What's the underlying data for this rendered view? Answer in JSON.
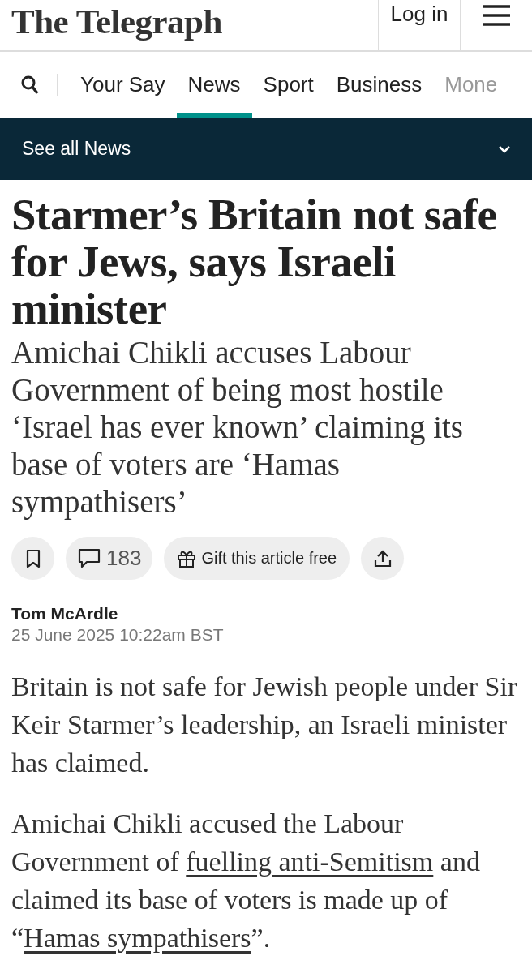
{
  "header": {
    "logo": "The Telegraph",
    "login": "Log in"
  },
  "nav": {
    "tabs": [
      {
        "label": "Your Say",
        "selected": false
      },
      {
        "label": "News",
        "selected": true
      },
      {
        "label": "Sport",
        "selected": false
      },
      {
        "label": "Business",
        "selected": false
      },
      {
        "label": "Mone",
        "selected": false
      }
    ]
  },
  "section_bar": {
    "label": "See all News",
    "expanded": false
  },
  "article": {
    "headline": "Starmer’s Britain not safe for Jews, says Israeli minister",
    "standfirst": "Amichai Chikli accuses Labour Government of being most hostile ‘Israel has ever known’ claiming its base of voters are ‘Hamas sympathisers’",
    "actions": {
      "comments": "183",
      "gift": "Gift this article free"
    },
    "author": "Tom McArdle",
    "date": "25 June 2025",
    "time": "10:22am BST",
    "paragraphs": [
      [
        {
          "text": "Britain is not safe for Jewish people under Sir Keir Starmer’s leadership, an Israeli minister has claimed.",
          "kind": "text"
        }
      ],
      [
        {
          "text": "Amichai Chikli accused the Labour Government of ",
          "kind": "text"
        },
        {
          "text": "fuelling anti-Semitism",
          "kind": "link"
        },
        {
          "text": " and claimed its base of voters is made up of “",
          "kind": "text"
        },
        {
          "text": "Hamas sympathisers",
          "kind": "link"
        },
        {
          "text": "”.",
          "kind": "text"
        }
      ]
    ]
  }
}
